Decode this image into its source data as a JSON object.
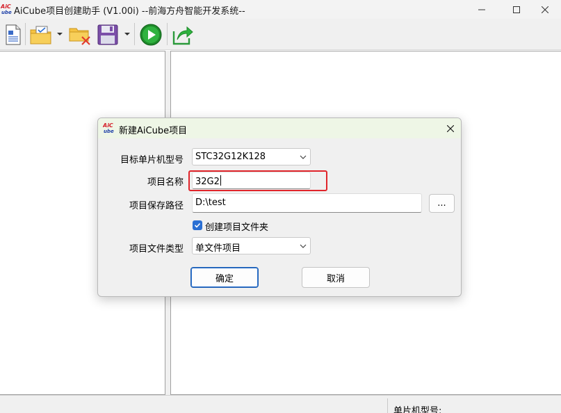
{
  "window": {
    "title": "AiCube项目创建助手 (V1.00i) --前海方舟智能开发系统--"
  },
  "toolbar": {
    "buttons": [
      {
        "icon": "new-document-icon"
      },
      {
        "icon": "open-folder-icon"
      },
      {
        "icon": "close-folder-icon"
      },
      {
        "icon": "save-disk-icon"
      },
      {
        "icon": "run-play-icon"
      },
      {
        "icon": "export-arrow-icon"
      }
    ]
  },
  "statusbar": {
    "mcu_label": "单片机型号:"
  },
  "dialog": {
    "title": "新建AiCube项目",
    "target_mcu_label": "目标单片机型号",
    "target_mcu_value": "STC32G12K128",
    "project_name_label": "项目名称",
    "project_name_value": "32G2",
    "save_path_label": "项目保存路径",
    "save_path_value": "D:\\test",
    "browse_label": "...",
    "create_folder_label": "创建项目文件夹",
    "create_folder_checked": true,
    "file_type_label": "项目文件类型",
    "file_type_value": "单文件项目",
    "ok_label": "确定",
    "cancel_label": "取消"
  },
  "colors": {
    "accent": "#2a6fd3",
    "highlight": "#e0242a",
    "dialog_title_bg": "#eef6e6"
  }
}
